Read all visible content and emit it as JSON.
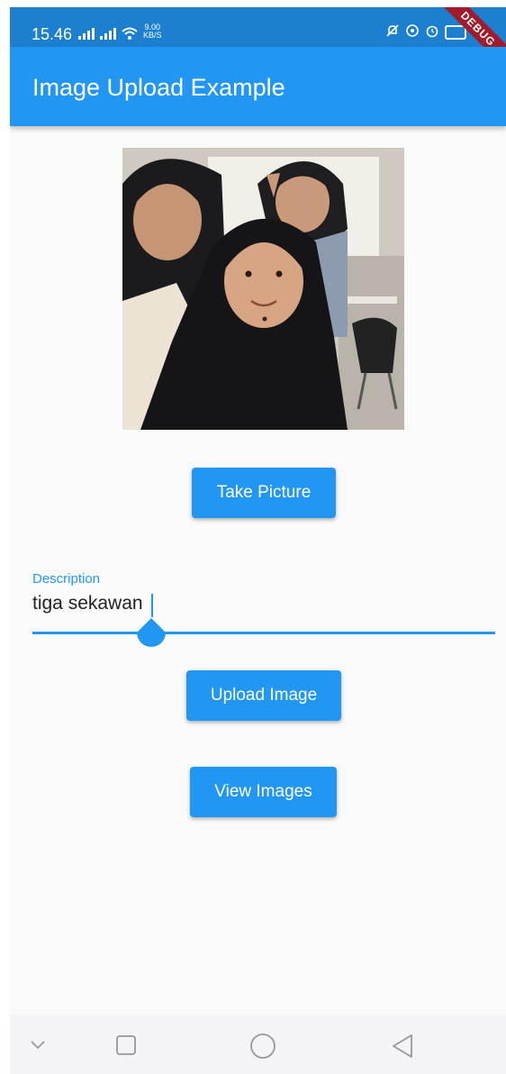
{
  "status_bar": {
    "time": "15.46",
    "net_speed_value": "9.00",
    "net_speed_unit": "KB/S",
    "debug_label": "DEBUG"
  },
  "app_bar": {
    "title": "Image Upload Example"
  },
  "buttons": {
    "take_picture": "Take Picture",
    "upload_image": "Upload Image",
    "view_images": "View Images"
  },
  "description_field": {
    "label": "Description",
    "value": "tiga sekawan"
  },
  "colors": {
    "primary": "#2196f3",
    "status_bar": "#1d7fd0",
    "debug_ribbon": "#a01c2c"
  },
  "icons": {
    "status_left": [
      "signal-icon",
      "signal-icon",
      "wifi-icon"
    ],
    "status_right": [
      "bell-off-icon",
      "sync-icon",
      "alarm-icon",
      "battery-icon"
    ],
    "nav": [
      "chevron-down-icon",
      "recents-square-icon",
      "home-circle-icon",
      "back-triangle-icon"
    ]
  }
}
